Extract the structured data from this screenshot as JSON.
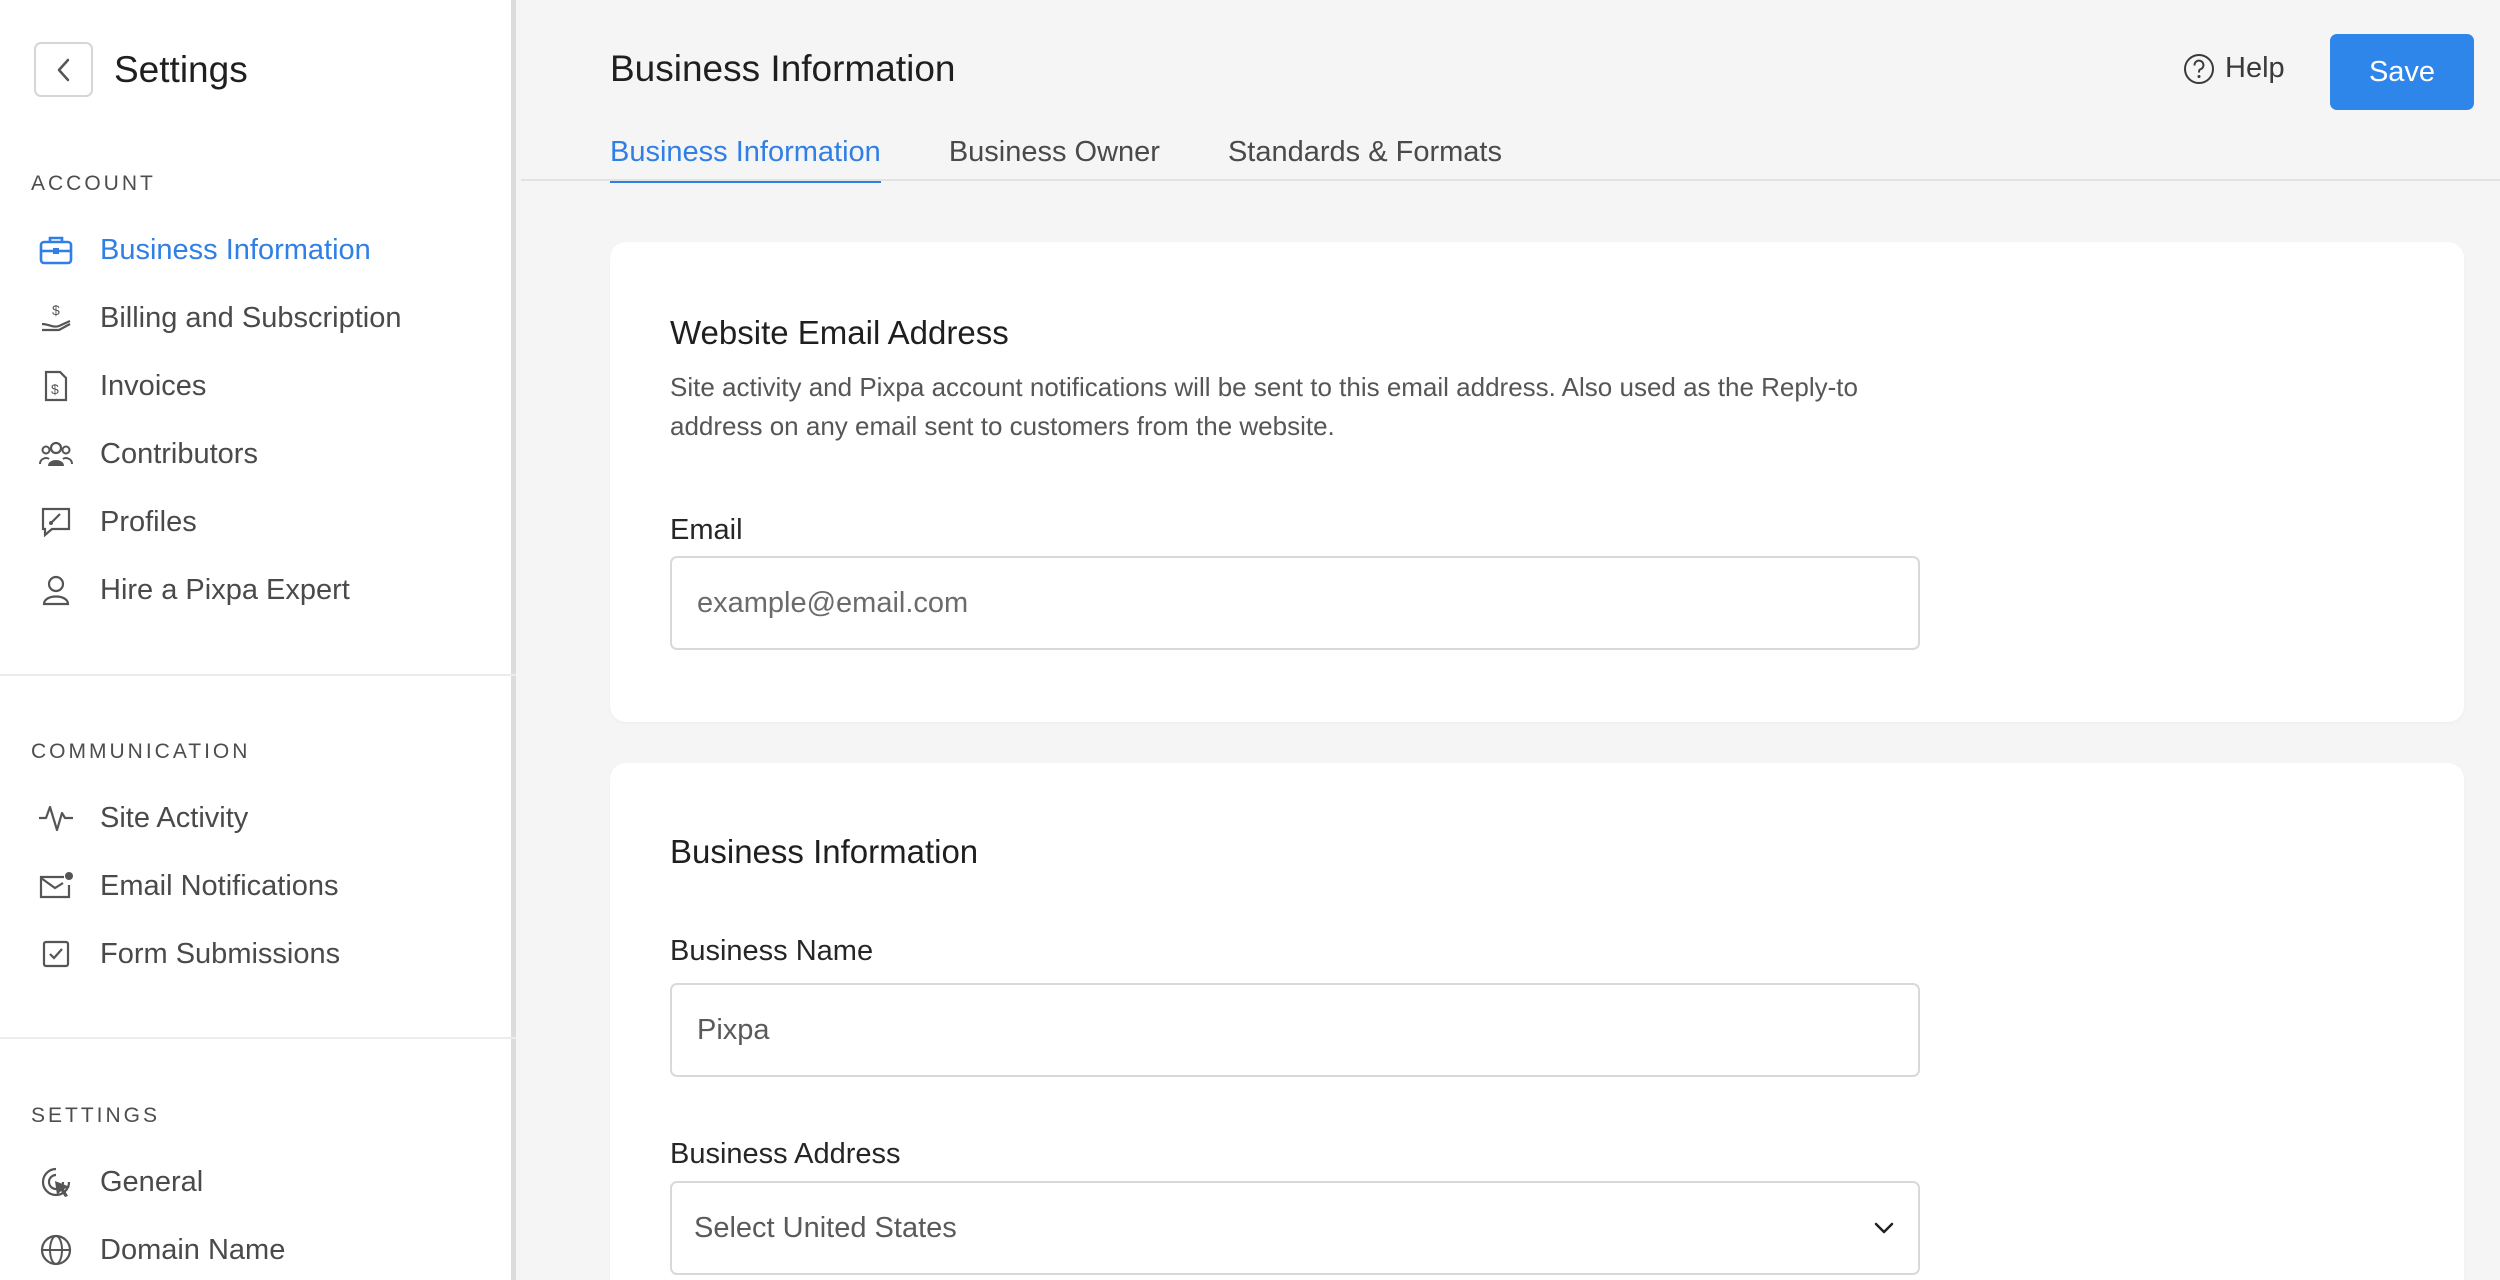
{
  "sidebar": {
    "title": "Settings",
    "sections": [
      {
        "label": "ACCOUNT",
        "items": [
          {
            "label": "Business Information",
            "icon": "briefcase-icon",
            "active": true
          },
          {
            "label": "Billing and Subscription",
            "icon": "hand-dollar-icon"
          },
          {
            "label": "Invoices",
            "icon": "invoice-icon"
          },
          {
            "label": "Contributors",
            "icon": "users-icon"
          },
          {
            "label": "Profiles",
            "icon": "profile-chat-icon"
          },
          {
            "label": "Hire a Pixpa Expert",
            "icon": "user-icon"
          }
        ]
      },
      {
        "label": "COMMUNICATION",
        "items": [
          {
            "label": "Site Activity",
            "icon": "activity-icon"
          },
          {
            "label": "Email Notifications",
            "icon": "mail-dot-icon"
          },
          {
            "label": "Form Submissions",
            "icon": "checkbox-icon"
          }
        ]
      },
      {
        "label": "SETTINGS",
        "items": [
          {
            "label": "General",
            "icon": "gear-pointer-icon"
          },
          {
            "label": "Domain Name",
            "icon": "globe-icon"
          }
        ]
      }
    ]
  },
  "header": {
    "title": "Business Information",
    "help_label": "Help",
    "save_label": "Save",
    "tabs": [
      {
        "label": "Business Information",
        "active": true
      },
      {
        "label": "Business Owner"
      },
      {
        "label": "Standards & Formats"
      }
    ]
  },
  "email_card": {
    "title": "Website Email Address",
    "description": "Site activity and Pixpa account notifications will be sent to this email address. Also used as the Reply-to address on any email sent to customers from the website.",
    "email_label": "Email",
    "email_placeholder": "example@email.com"
  },
  "business_card": {
    "title": "Business Information",
    "name_label": "Business Name",
    "name_value": "Pixpa",
    "address_label": "Business Address",
    "address_select": "Select United States"
  },
  "colors": {
    "accent": "#2f7fe6",
    "save_button": "#2f86ea",
    "background": "#f5f5f5"
  }
}
